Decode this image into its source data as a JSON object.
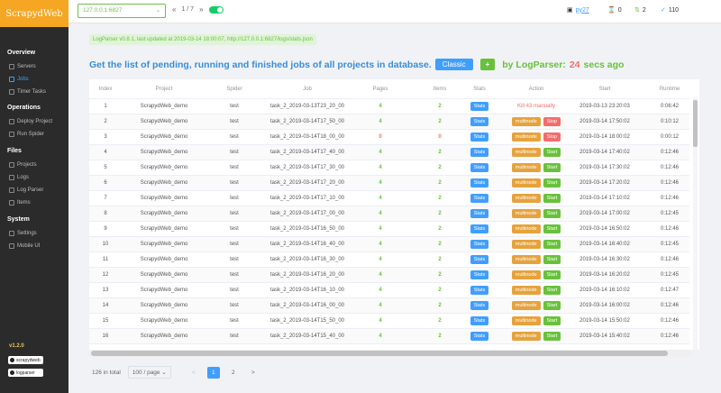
{
  "sidebar": {
    "logo": "ScrapydWeb",
    "sections": {
      "overview": "Overview",
      "operations": "Operations",
      "files": "Files",
      "system": "System"
    },
    "items": {
      "servers": "Servers",
      "jobs": "Jobs",
      "timer_tasks": "Timer Tasks",
      "deploy_project": "Deploy Project",
      "run_spider": "Run Spider",
      "projects": "Projects",
      "logs": "Logs",
      "log_parser": "Log Parser",
      "items": "Items",
      "settings": "Settings",
      "mobile_ui": "Mobile UI"
    },
    "version": "v1.2.0",
    "badges": {
      "scrapydweb": "scrapydweb",
      "logparser": "logparser"
    }
  },
  "topbar": {
    "node_select": "127.0.0.1:6827",
    "page_indicator": "1 / 7",
    "prev": "«",
    "next": "»",
    "python_version": "py27",
    "hourglass_count": "0",
    "sort_count": "2",
    "check_count": "110"
  },
  "info_bar": "LogParser v0.8.1, last updated at 2019-03-14 18:00:07, http://127.0.0.1:6827/logs/stats.json",
  "heading": {
    "text": "Get the list of pending, running and finished jobs of all projects in database.",
    "classic_button": "Classic",
    "plus_button": "+",
    "by_logparser": "by LogParser:",
    "secs_value": "24",
    "secs_suffix": "secs ago"
  },
  "table": {
    "headers": [
      "Index",
      "Project",
      "Spider",
      "Job",
      "Pages",
      "Items",
      "Stats",
      "Action",
      "Start",
      "Runtime"
    ],
    "rows": [
      {
        "index": "1",
        "project": "ScrapydWeb_demo",
        "spider": "test",
        "job": "task_2_2019-03-13T23_20_00",
        "pages": "4",
        "items": "2",
        "stats": "Stats",
        "action": [
          "Kill 43 manually"
        ],
        "start": "2019-03-13 23:20:03",
        "runtime": "0:06:42"
      },
      {
        "index": "2",
        "project": "ScrapydWeb_demo",
        "spider": "test",
        "job": "task_2_2019-03-14T17_50_00",
        "pages": "4",
        "items": "2",
        "stats": "Stats",
        "action": [
          "multinode",
          "Stop"
        ],
        "start": "2019-03-14 17:50:02",
        "runtime": "0:10:12"
      },
      {
        "index": "3",
        "project": "ScrapydWeb_demo",
        "spider": "test",
        "job": "task_2_2019-03-14T18_00_00",
        "pages": "0",
        "items": "0",
        "stats": "Stats",
        "action": [
          "multinode",
          "Stop"
        ],
        "start": "2019-03-14 18:00:02",
        "runtime": "0:00:12"
      },
      {
        "index": "4",
        "project": "ScrapydWeb_demo",
        "spider": "test",
        "job": "task_2_2019-03-14T17_40_00",
        "pages": "4",
        "items": "2",
        "stats": "Stats",
        "action": [
          "multinode",
          "Start"
        ],
        "start": "2019-03-14 17:40:02",
        "runtime": "0:12:46"
      },
      {
        "index": "5",
        "project": "ScrapydWeb_demo",
        "spider": "test",
        "job": "task_2_2019-03-14T17_30_00",
        "pages": "4",
        "items": "2",
        "stats": "Stats",
        "action": [
          "multinode",
          "Start"
        ],
        "start": "2019-03-14 17:30:02",
        "runtime": "0:12:46"
      },
      {
        "index": "6",
        "project": "ScrapydWeb_demo",
        "spider": "test",
        "job": "task_2_2019-03-14T17_20_00",
        "pages": "4",
        "items": "2",
        "stats": "Stats",
        "action": [
          "multinode",
          "Start"
        ],
        "start": "2019-03-14 17:20:02",
        "runtime": "0:12:46"
      },
      {
        "index": "7",
        "project": "ScrapydWeb_demo",
        "spider": "test",
        "job": "task_2_2019-03-14T17_10_00",
        "pages": "4",
        "items": "2",
        "stats": "Stats",
        "action": [
          "multinode",
          "Start"
        ],
        "start": "2019-03-14 17:10:02",
        "runtime": "0:12:46"
      },
      {
        "index": "8",
        "project": "ScrapydWeb_demo",
        "spider": "test",
        "job": "task_2_2019-03-14T17_00_00",
        "pages": "4",
        "items": "2",
        "stats": "Stats",
        "action": [
          "multinode",
          "Start"
        ],
        "start": "2019-03-14 17:00:02",
        "runtime": "0:12:45"
      },
      {
        "index": "9",
        "project": "ScrapydWeb_demo",
        "spider": "test",
        "job": "task_2_2019-03-14T16_50_00",
        "pages": "4",
        "items": "2",
        "stats": "Stats",
        "action": [
          "multinode",
          "Start"
        ],
        "start": "2019-03-14 16:50:02",
        "runtime": "0:12:46"
      },
      {
        "index": "10",
        "project": "ScrapydWeb_demo",
        "spider": "test",
        "job": "task_2_2019-03-14T16_40_00",
        "pages": "4",
        "items": "2",
        "stats": "Stats",
        "action": [
          "multinode",
          "Start"
        ],
        "start": "2019-03-14 16:40:02",
        "runtime": "0:12:45"
      },
      {
        "index": "11",
        "project": "ScrapydWeb_demo",
        "spider": "test",
        "job": "task_2_2019-03-14T16_30_00",
        "pages": "4",
        "items": "2",
        "stats": "Stats",
        "action": [
          "multinode",
          "Start"
        ],
        "start": "2019-03-14 16:30:02",
        "runtime": "0:12:46"
      },
      {
        "index": "12",
        "project": "ScrapydWeb_demo",
        "spider": "test",
        "job": "task_2_2019-03-14T16_20_00",
        "pages": "4",
        "items": "2",
        "stats": "Stats",
        "action": [
          "multinode",
          "Start"
        ],
        "start": "2019-03-14 16:20:02",
        "runtime": "0:12:45"
      },
      {
        "index": "13",
        "project": "ScrapydWeb_demo",
        "spider": "test",
        "job": "task_2_2019-03-14T16_10_00",
        "pages": "4",
        "items": "2",
        "stats": "Stats",
        "action": [
          "multinode",
          "Start"
        ],
        "start": "2019-03-14 16:10:02",
        "runtime": "0:12:47"
      },
      {
        "index": "14",
        "project": "ScrapydWeb_demo",
        "spider": "test",
        "job": "task_2_2019-03-14T16_00_00",
        "pages": "4",
        "items": "2",
        "stats": "Stats",
        "action": [
          "multinode",
          "Start"
        ],
        "start": "2019-03-14 16:00:02",
        "runtime": "0:12:46"
      },
      {
        "index": "15",
        "project": "ScrapydWeb_demo",
        "spider": "test",
        "job": "task_2_2019-03-14T15_50_00",
        "pages": "4",
        "items": "2",
        "stats": "Stats",
        "action": [
          "multinode",
          "Start"
        ],
        "start": "2019-03-14 15:50:02",
        "runtime": "0:12:46"
      },
      {
        "index": "16",
        "project": "ScrapydWeb_demo",
        "spider": "test",
        "job": "task_2_2019-03-14T15_40_00",
        "pages": "4",
        "items": "2",
        "stats": "Stats",
        "action": [
          "multinode",
          "Start"
        ],
        "start": "2019-03-14 15:40:02",
        "runtime": "0:12:46"
      }
    ]
  },
  "footer": {
    "total": "126 in total",
    "page_size": "100 / page",
    "pages": [
      "1",
      "2"
    ],
    "prev": "<",
    "next": ">"
  },
  "colors": {
    "accent": "#409eff",
    "success": "#67c23a",
    "danger": "#f56c6c",
    "warning": "#e6a23c",
    "brand": "#f5a623"
  }
}
